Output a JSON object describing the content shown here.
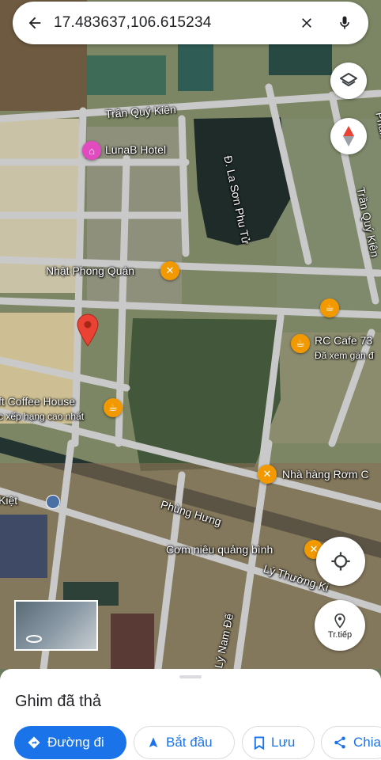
{
  "search": {
    "query": "17.483637,106.615234"
  },
  "map": {
    "streets": [
      "Trần Quý Kiên",
      "Đ. La Sơn Phu Tử",
      "Trần Quý Kiên",
      "Phan",
      "Phùng Hưng",
      "Lý Thường Ki",
      "Lý Nam Đế",
      "Kiệt"
    ],
    "pois": [
      {
        "name": "LunaB Hotel"
      },
      {
        "name": "Nhật Phong Quán"
      },
      {
        "name": "RC Cafe 73",
        "sub": "Đã xem gần đ"
      },
      {
        "name": "ft Coffee House",
        "sub": "c xếp hạng cao nhất"
      },
      {
        "name": "Nhà hàng Rơm C"
      },
      {
        "name": "Cơm niêu quảng bình"
      }
    ],
    "streetview_label": "Tr.tiếp"
  },
  "sheet": {
    "title": "Ghim đã thả",
    "actions": [
      "Đường đi",
      "Bắt đầu",
      "Lưu",
      "Chia"
    ]
  },
  "colors": {
    "accent": "#1a73e8",
    "pin": "#ea4335",
    "food": "#f29900",
    "hotel": "#e24bbf"
  }
}
